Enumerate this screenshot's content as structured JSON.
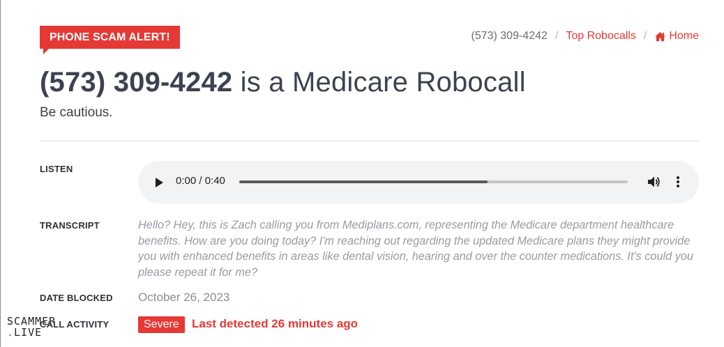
{
  "alert_badge": "PHONE SCAM ALERT!",
  "breadcrumb": {
    "current": "(573) 309-4242",
    "separator": "/",
    "top_robocalls": "Top Robocalls",
    "home": "Home"
  },
  "title": {
    "number": "(573) 309-4242",
    "rest": " is a Medicare Robocall"
  },
  "subtitle": "Be cautious.",
  "rows": {
    "listen_label": "LISTEN",
    "transcript_label": "TRANSCRIPT",
    "date_label": "DATE BLOCKED",
    "activity_label": "CALL ACTIVITY"
  },
  "player": {
    "time": "0:00 / 0:40",
    "progress": 0.64
  },
  "transcript": "Hello? Hey, this is Zach calling you from Mediplans.com, representing the Medicare department healthcare benefits. How are you doing today? I'm reaching out regarding the updated Medicare plans they might provide you with enhanced benefits in areas like dental vision, hearing and over the counter medications. It's could you please repeat it for me?",
  "date_blocked": "October 26, 2023",
  "activity": {
    "severity": "Severe",
    "last_detected": "Last detected 26 minutes ago"
  },
  "watermark": {
    "line1": "SCAMMER",
    "dot": ".",
    "line2": "LIVE"
  },
  "colors": {
    "accent": "#e53935",
    "title": "#3d4250",
    "muted": "#9a9aa4"
  }
}
